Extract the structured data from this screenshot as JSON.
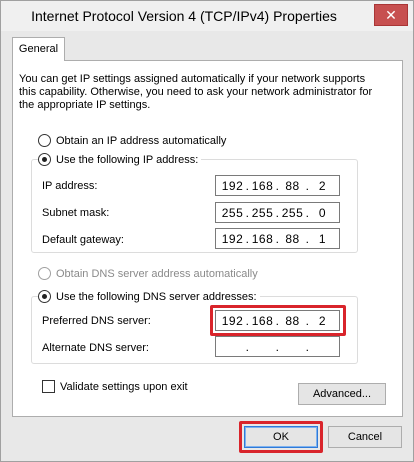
{
  "window": {
    "title": "Internet Protocol Version 4 (TCP/IPv4) Properties",
    "close_glyph": "✕"
  },
  "tabs": [
    {
      "label": "General"
    }
  ],
  "intro_text": "You can get IP settings assigned automatically if your network supports this capability. Otherwise, you need to ask your network administrator for the appropriate IP settings.",
  "ip_section": {
    "obtain_auto_label": "Obtain an IP address automatically",
    "use_following_label": "Use the following IP address:",
    "fields": [
      {
        "label": "IP address:",
        "octets": [
          "192",
          "168",
          "88",
          "2"
        ]
      },
      {
        "label": "Subnet mask:",
        "octets": [
          "255",
          "255",
          "255",
          "0"
        ]
      },
      {
        "label": "Default gateway:",
        "octets": [
          "192",
          "168",
          "88",
          "1"
        ]
      }
    ]
  },
  "dns_section": {
    "obtain_auto_label": "Obtain DNS server address automatically",
    "use_following_label": "Use the following DNS server addresses:",
    "fields": [
      {
        "label": "Preferred DNS server:",
        "octets": [
          "192",
          "168",
          "88",
          "2"
        ]
      },
      {
        "label": "Alternate DNS server:",
        "octets": [
          "",
          "",
          "",
          ""
        ]
      }
    ]
  },
  "validate_label": "Validate settings upon exit",
  "buttons": {
    "advanced": "Advanced...",
    "ok": "OK",
    "cancel": "Cancel"
  },
  "colors": {
    "highlight": "#d9242b",
    "close_button": "#c75050"
  }
}
